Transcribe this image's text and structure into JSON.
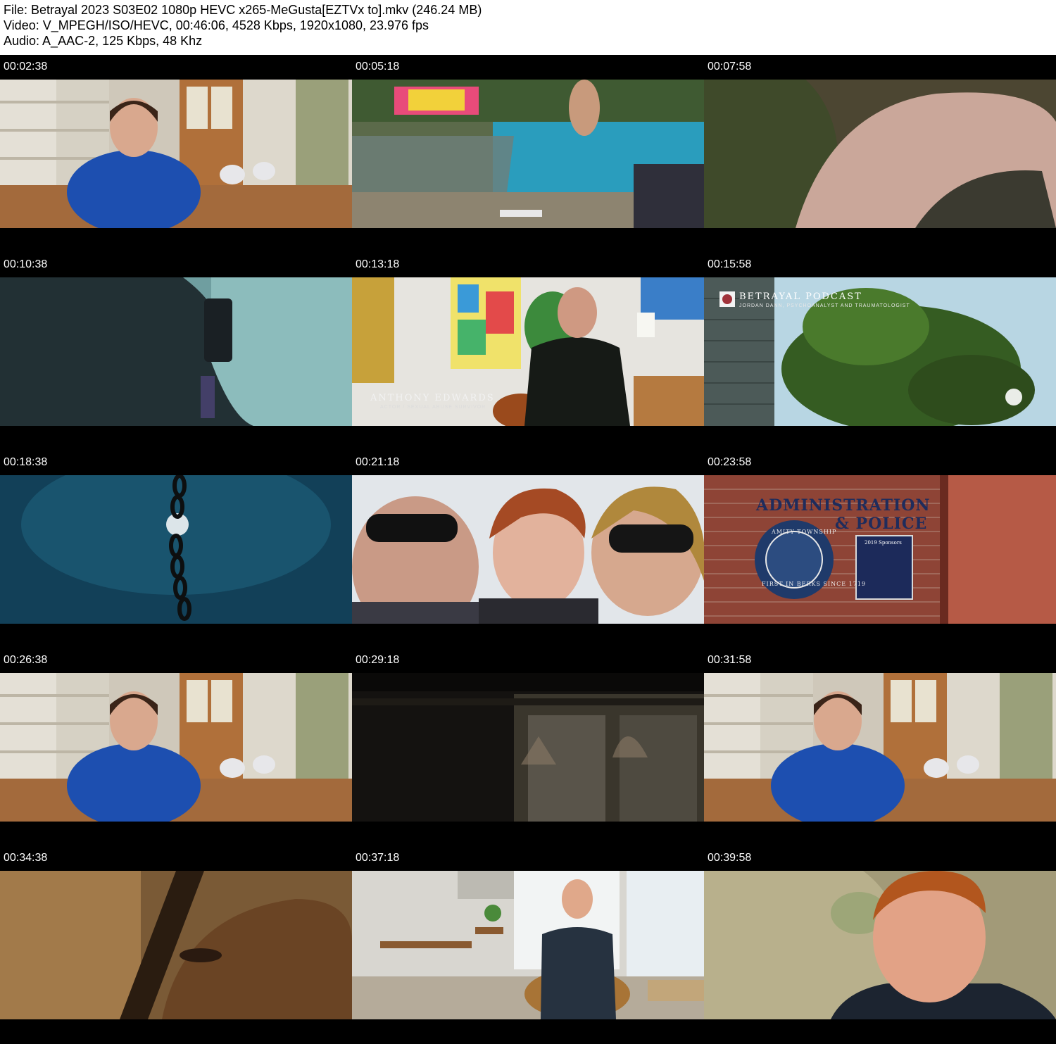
{
  "header": {
    "file_line": "File: Betrayal 2023 S03E02 1080p HEVC x265-MeGusta[EZTVx to].mkv (246.24 MB)",
    "video_line": "Video: V_MPEGH/ISO/HEVC, 00:46:06, 4528 Kbps, 1920x1080, 23.976 fps",
    "audio_line": "Audio: A_AAC-2, 125 Kbps, 48 Khz"
  },
  "thumbnails": [
    {
      "timestamp": "00:02:38"
    },
    {
      "timestamp": "00:05:18"
    },
    {
      "timestamp": "00:07:58"
    },
    {
      "timestamp": "00:10:38"
    },
    {
      "timestamp": "00:13:18",
      "overlay_name": "ANTHONY EDWARDS",
      "overlay_role": "ACTOR / SEXUAL ABUSE SURVIVOR"
    },
    {
      "timestamp": "00:15:58",
      "overlay_title": "BETRAYAL PODCAST",
      "overlay_sub": "JORDAN DANN, PSYCHOANALYST AND TRAUMATOLOGIST"
    },
    {
      "timestamp": "00:18:38"
    },
    {
      "timestamp": "00:21:18"
    },
    {
      "timestamp": "00:23:58",
      "sign_line1": "ADMINISTRATION",
      "sign_line2": "& POLICE",
      "seal_top": "AMITY TOWNSHIP",
      "seal_bottom": "FIRST IN BERKS SINCE 1719",
      "plaque": "2019 Sponsors"
    },
    {
      "timestamp": "00:26:38"
    },
    {
      "timestamp": "00:29:18"
    },
    {
      "timestamp": "00:31:58"
    },
    {
      "timestamp": "00:34:38"
    },
    {
      "timestamp": "00:37:18"
    },
    {
      "timestamp": "00:39:58"
    }
  ]
}
